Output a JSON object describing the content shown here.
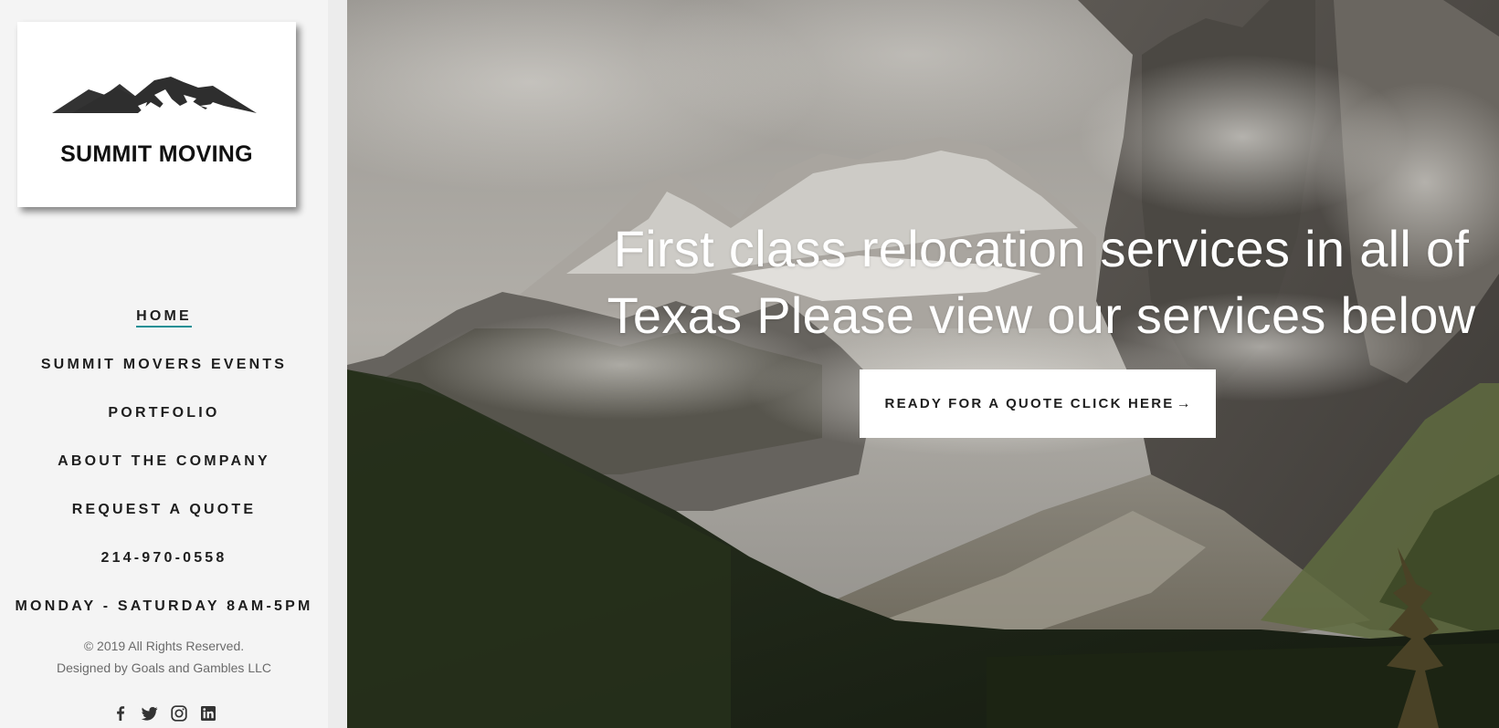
{
  "brand": {
    "logo_text": "SUMMIT MOVING"
  },
  "nav": {
    "items": [
      {
        "label": "HOME",
        "active": true
      },
      {
        "label": "SUMMIT MOVERS EVENTS",
        "active": false
      },
      {
        "label": "PORTFOLIO",
        "active": false
      },
      {
        "label": "ABOUT THE COMPANY",
        "active": false
      },
      {
        "label": "REQUEST A QUOTE",
        "active": false
      },
      {
        "label": "214-970-0558",
        "active": false
      },
      {
        "label": "MONDAY - SATURDAY 8AM-5PM",
        "active": false
      }
    ]
  },
  "footer": {
    "copyright": "© 2019 All Rights Reserved.",
    "designer": "Designed by Goals and Gambles LLC"
  },
  "social": [
    {
      "icon": "facebook-icon"
    },
    {
      "icon": "twitter-icon"
    },
    {
      "icon": "instagram-icon"
    },
    {
      "icon": "linkedin-icon"
    }
  ],
  "hero": {
    "headline_line1": "First class relocation services in all of",
    "headline_line2": "Texas Please view our services below",
    "cta_label": "READY FOR A QUOTE CLICK HERE",
    "cta_arrow": "→"
  },
  "colors": {
    "accent": "#1b8f95",
    "sidebar_bg": "#f4f4f4",
    "text_dark": "#1e1e1e"
  }
}
